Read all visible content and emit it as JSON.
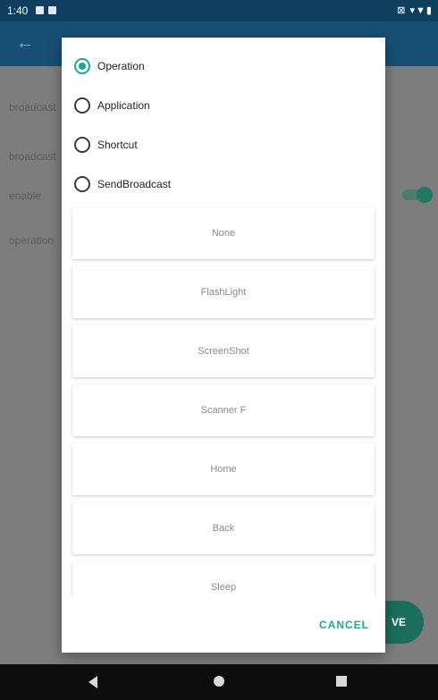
{
  "status_bar": {
    "time": "1:40",
    "right_icons": "⊠ ▾▼▮"
  },
  "app_bar": {
    "back_icon": "arrow-left-icon"
  },
  "background": {
    "rows": [
      "broadcast",
      "broadcast",
      "enable",
      "operation"
    ],
    "fab_label": "VE"
  },
  "dialog": {
    "radio_options": [
      {
        "label": "Operation",
        "checked": true
      },
      {
        "label": "Application",
        "checked": false
      },
      {
        "label": "Shortcut",
        "checked": false
      },
      {
        "label": "SendBroadcast",
        "checked": false
      }
    ],
    "operations": [
      "None",
      "FlashLight",
      "ScreenShot",
      "Scanner F",
      "Home",
      "Back",
      "Sleep"
    ],
    "cancel_label": "CANCEL"
  },
  "colors": {
    "accent": "#19a895",
    "app_bar": "#174f74",
    "status_bar": "#0f3f5e"
  }
}
